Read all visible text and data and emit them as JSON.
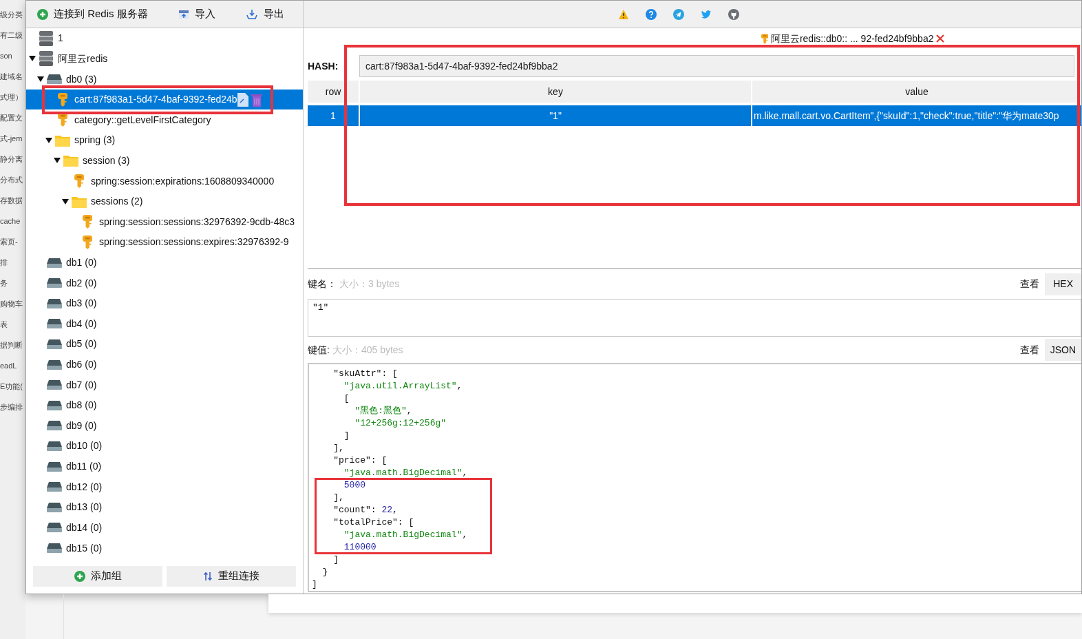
{
  "background_texts": [
    "级分类",
    "有二级",
    "son",
    "建域名",
    "式理）",
    "配置文",
    "式-jem",
    "静分离",
    "分布式",
    "存数据",
    "cache",
    "索页-",
    "排",
    "务",
    "购物车",
    "表",
    "据判断",
    "eadL",
    "E功能(",
    "步编排"
  ],
  "toolbar": [
    {
      "kind": "connect",
      "label": "连接到 Redis 服务器"
    },
    {
      "kind": "import",
      "label": "导入"
    },
    {
      "kind": "export",
      "label": "导出"
    }
  ],
  "tree": [
    {
      "kind": "connection",
      "label": "1",
      "expanded": false,
      "selected": false
    },
    {
      "kind": "connection",
      "label": "阿里云redis",
      "expanded": true,
      "selected": false,
      "children": [
        {
          "kind": "db",
          "label": "db0  (3)",
          "expanded": true,
          "selected": false,
          "children": [
            {
              "kind": "key",
              "label": "cart:87f983a1-5d47-4baf-9392-fed24b",
              "selected": true
            },
            {
              "kind": "key",
              "label": "category::getLevelFirstCategory",
              "selected": false
            },
            {
              "kind": "folder",
              "label": "spring (3)",
              "expanded": true,
              "selected": false,
              "children": [
                {
                  "kind": "folder",
                  "label": "session (3)",
                  "expanded": true,
                  "selected": false,
                  "children": [
                    {
                      "kind": "key",
                      "label": "spring:session:expirations:1608809340000",
                      "selected": false
                    },
                    {
                      "kind": "folder",
                      "label": "sessions (2)",
                      "expanded": true,
                      "selected": false,
                      "children": [
                        {
                          "kind": "key",
                          "label": "spring:session:sessions:32976392-9cdb-48c3",
                          "selected": false
                        },
                        {
                          "kind": "key",
                          "label": "spring:session:sessions:expires:32976392-9",
                          "selected": false
                        }
                      ]
                    }
                  ]
                }
              ]
            }
          ]
        },
        {
          "kind": "db",
          "label": "db1  (0)",
          "selected": false
        },
        {
          "kind": "db",
          "label": "db2  (0)",
          "selected": false
        },
        {
          "kind": "db",
          "label": "db3  (0)",
          "selected": false
        },
        {
          "kind": "db",
          "label": "db4  (0)",
          "selected": false
        },
        {
          "kind": "db",
          "label": "db5  (0)",
          "selected": false
        },
        {
          "kind": "db",
          "label": "db6  (0)",
          "selected": false
        },
        {
          "kind": "db",
          "label": "db7  (0)",
          "selected": false
        },
        {
          "kind": "db",
          "label": "db8  (0)",
          "selected": false
        },
        {
          "kind": "db",
          "label": "db9  (0)",
          "selected": false
        },
        {
          "kind": "db",
          "label": "db10  (0)",
          "selected": false
        },
        {
          "kind": "db",
          "label": "db11  (0)",
          "selected": false
        },
        {
          "kind": "db",
          "label": "db12  (0)",
          "selected": false
        },
        {
          "kind": "db",
          "label": "db13  (0)",
          "selected": false
        },
        {
          "kind": "db",
          "label": "db14  (0)",
          "selected": false
        },
        {
          "kind": "db",
          "label": "db15  (0)",
          "selected": false
        }
      ]
    }
  ],
  "bottom_buttons": [
    {
      "kind": "add",
      "label": "添加组"
    },
    {
      "kind": "reorder",
      "label": "重组连接"
    }
  ],
  "top_icons": [
    {
      "kind": "warning"
    },
    {
      "kind": "help"
    },
    {
      "kind": "telegram"
    },
    {
      "kind": "twitter"
    },
    {
      "kind": "github"
    }
  ],
  "tab": {
    "label": "阿里云redis::db0:: ... 92-fed24bf9bba2"
  },
  "hash": {
    "label": "HASH:",
    "value": "cart:87f983a1-5d47-4baf-9392-fed24bf9bba2"
  },
  "table": {
    "columns": [
      "row",
      "key",
      "value"
    ],
    "rows": [
      {
        "selected": true,
        "cells": [
          "1",
          "\"1\"",
          "m.like.mall.cart.vo.CartItem\",{\"skuId\":1,\"check\":true,\"title\":\"华为mate30p"
        ]
      }
    ]
  },
  "key_section": {
    "label": "键名：",
    "size": "大小：3 bytes",
    "view_label": "查看",
    "format": "HEX",
    "value": "\"1\""
  },
  "value_section": {
    "label": "键值:",
    "size": "大小：405 bytes",
    "view_label": "查看",
    "format": "JSON",
    "lines": [
      [
        {
          "kind": "key",
          "text": "    \"skuAttr\""
        },
        {
          "kind": "punct",
          "text": ": ["
        }
      ],
      [
        {
          "kind": "string",
          "text": "      \"java.util.ArrayList\""
        },
        {
          "kind": "punct",
          "text": ","
        }
      ],
      [
        {
          "kind": "punct",
          "text": "      ["
        }
      ],
      [
        {
          "kind": "string",
          "text": "        \"黑色:黑色\""
        },
        {
          "kind": "punct",
          "text": ","
        }
      ],
      [
        {
          "kind": "string",
          "text": "        \"12+256g:12+256g\""
        }
      ],
      [
        {
          "kind": "punct",
          "text": "      ]"
        }
      ],
      [
        {
          "kind": "punct",
          "text": "    ],"
        }
      ],
      [
        {
          "kind": "key",
          "text": "    \"price\""
        },
        {
          "kind": "punct",
          "text": ": ["
        }
      ],
      [
        {
          "kind": "string",
          "text": "      \"java.math.BigDecimal\""
        },
        {
          "kind": "punct",
          "text": ","
        }
      ],
      [
        {
          "kind": "number",
          "text": "      5000"
        }
      ],
      [
        {
          "kind": "punct",
          "text": "    ],"
        }
      ],
      [
        {
          "kind": "key",
          "text": "    \"count\""
        },
        {
          "kind": "punct",
          "text": ": "
        },
        {
          "kind": "number",
          "text": "22"
        },
        {
          "kind": "punct",
          "text": ","
        }
      ],
      [
        {
          "kind": "key",
          "text": "    \"totalPrice\""
        },
        {
          "kind": "punct",
          "text": ": ["
        }
      ],
      [
        {
          "kind": "string",
          "text": "      \"java.math.BigDecimal\""
        },
        {
          "kind": "punct",
          "text": ","
        }
      ],
      [
        {
          "kind": "number",
          "text": "      110000"
        }
      ],
      [
        {
          "kind": "punct",
          "text": "    ]"
        }
      ],
      [
        {
          "kind": "punct",
          "text": "  }"
        }
      ],
      [
        {
          "kind": "punct",
          "text": "]"
        }
      ]
    ]
  }
}
